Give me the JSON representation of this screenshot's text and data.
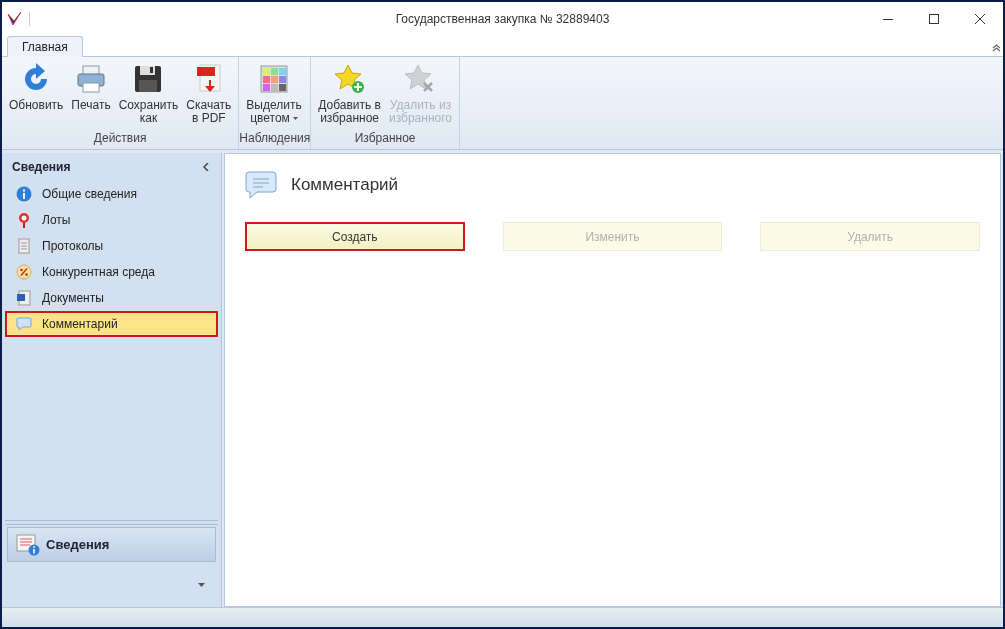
{
  "window": {
    "title": "Государственная закупка № 32889403"
  },
  "tabs": [
    {
      "label": "Главная",
      "selected": true
    }
  ],
  "ribbon": [
    {
      "label": "Действия",
      "buttons": [
        {
          "kind": "refresh",
          "lines": [
            "Обновить"
          ],
          "disabled": false,
          "dropdown": false
        },
        {
          "kind": "print",
          "lines": [
            "Печать"
          ],
          "disabled": false,
          "dropdown": false
        },
        {
          "kind": "save",
          "lines": [
            "Сохранить",
            "как"
          ],
          "disabled": false,
          "dropdown": false
        },
        {
          "kind": "pdf",
          "lines": [
            "Скачать",
            "в PDF"
          ],
          "disabled": false,
          "dropdown": false
        }
      ]
    },
    {
      "label": "Наблюдения",
      "buttons": [
        {
          "kind": "palette",
          "lines": [
            "Выделить",
            "цветом"
          ],
          "disabled": false,
          "dropdown": true
        }
      ]
    },
    {
      "label": "Избранное",
      "buttons": [
        {
          "kind": "star_add",
          "lines": [
            "Добавить в",
            "избранное"
          ],
          "disabled": false,
          "dropdown": false
        },
        {
          "kind": "star_remove",
          "lines": [
            "Удалить из",
            "избранного"
          ],
          "disabled": true,
          "dropdown": false
        }
      ]
    }
  ],
  "sidebar": {
    "title": "Сведения",
    "items": [
      {
        "kind": "info",
        "label": "Общие сведения",
        "selected": false
      },
      {
        "kind": "lots",
        "label": "Лоты",
        "selected": false
      },
      {
        "kind": "protocol",
        "label": "Протоколы",
        "selected": false
      },
      {
        "kind": "percent",
        "label": "Конкурентная среда",
        "selected": false
      },
      {
        "kind": "document",
        "label": "Документы",
        "selected": false
      },
      {
        "kind": "comment",
        "label": "Комментарий",
        "selected": true
      }
    ],
    "nav_button": {
      "label": "Сведения"
    }
  },
  "content": {
    "title": "Комментарий",
    "buttons": [
      {
        "label": "Создать",
        "disabled": false,
        "focused": true
      },
      {
        "label": "Изменить",
        "disabled": true,
        "focused": false
      },
      {
        "label": "Удалить",
        "disabled": true,
        "focused": false
      }
    ]
  }
}
